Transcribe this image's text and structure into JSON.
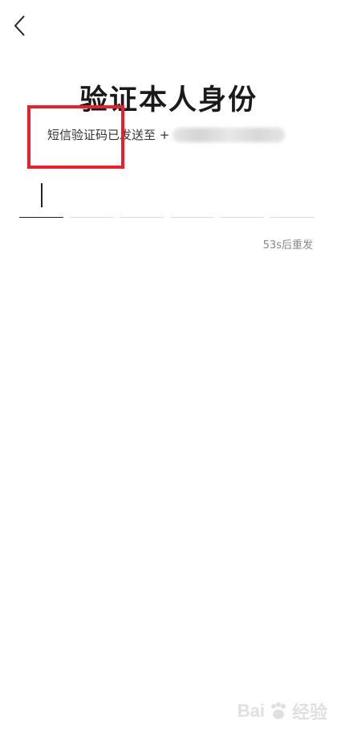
{
  "header": {
    "back_icon": "chevron-left-icon"
  },
  "main": {
    "title": "验证本人身份",
    "sms_prefix": "短信验证码已发送至 +",
    "code_slots": 6,
    "resend_label": "53s后重发"
  },
  "annotation": {
    "highlight_color": "#e5212c"
  },
  "watermark": {
    "text": "Bai",
    "text2": "经验",
    "icon": "baidu-paw-icon"
  }
}
